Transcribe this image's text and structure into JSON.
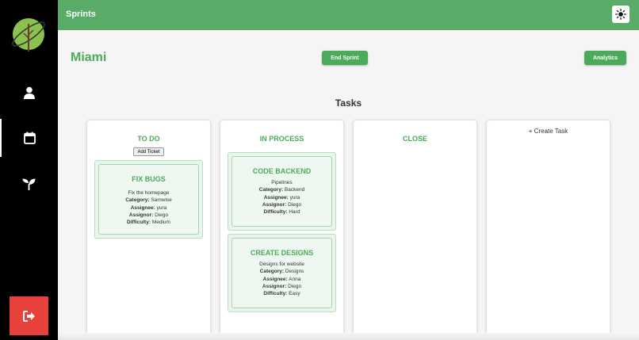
{
  "header": {
    "title": "Sprints",
    "theme_icon": "sun-icon"
  },
  "sidebar": {
    "logo_icon": "planet-tree-logo",
    "items": [
      {
        "icon": "user-icon",
        "active": false
      },
      {
        "icon": "calendar-icon",
        "active": true
      },
      {
        "icon": "sprout-icon",
        "active": false
      }
    ],
    "logout_icon": "logout-icon"
  },
  "sprint": {
    "name": "Miami",
    "end_label": "End Sprint",
    "analytics_label": "Analytics"
  },
  "tasks_heading": "Tasks",
  "columns": {
    "todo": {
      "title": "TO DO",
      "add_ticket_label": "Add Ticket",
      "cards": [
        {
          "title": "FIX BUGS",
          "description": "Fix the homepage",
          "category": "Samwise",
          "assignee": "yura",
          "assignor": "Diego",
          "difficulty": "Medium"
        }
      ]
    },
    "in_process": {
      "title": "IN PROCESS",
      "cards": [
        {
          "title": "CODE BACKEND",
          "description": "Pipelines",
          "category": "Backend",
          "assignee": "yura",
          "assignor": "Diego",
          "difficulty": "Hard"
        },
        {
          "title": "CREATE DESIGNS",
          "description": "Designs for website",
          "category": "Designs",
          "assignee": "Anna",
          "assignor": "Diego",
          "difficulty": "Easy"
        }
      ]
    },
    "close": {
      "title": "CLOSE",
      "cards": []
    },
    "create": {
      "label": "+ Create Task"
    }
  },
  "field_labels": {
    "category": "Category:",
    "assignee": "Assignee:",
    "assignor": "Assignor:",
    "difficulty": "Difficulty:"
  },
  "colors": {
    "header_green": "#58ac68",
    "accent_green": "#4caa5b",
    "sidebar_black": "#000000",
    "logout_red": "#e8403a",
    "card_bg": "#eaf5ec"
  }
}
